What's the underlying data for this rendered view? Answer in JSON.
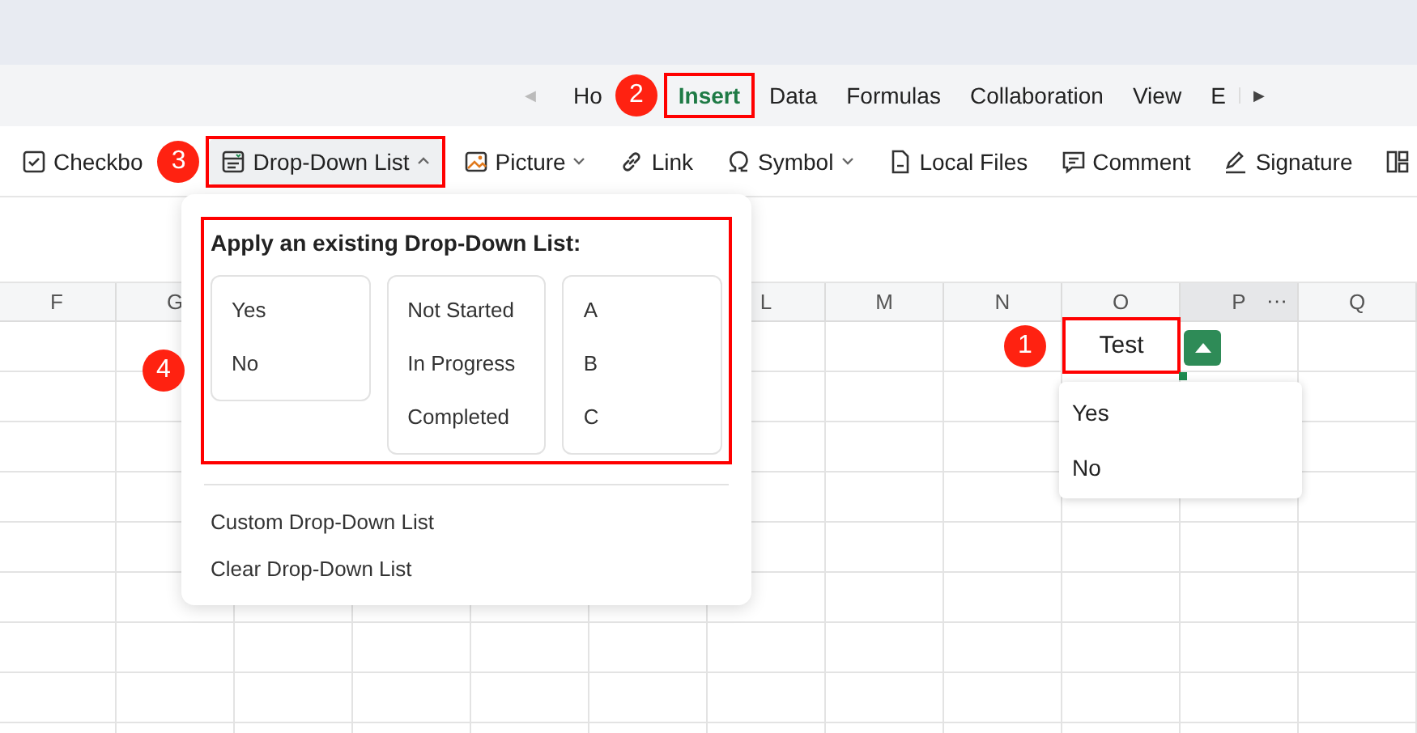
{
  "tab_bar": {
    "scroll_left": "◀",
    "scroll_right": "▶",
    "tabs": [
      {
        "label": "Ho",
        "selected": false,
        "outlined": false
      },
      {
        "label": "Insert",
        "selected": true,
        "outlined": true,
        "badge": "2"
      },
      {
        "label": "Data",
        "selected": false,
        "outlined": false
      },
      {
        "label": "Formulas",
        "selected": false,
        "outlined": false
      },
      {
        "label": "Collaboration",
        "selected": false,
        "outlined": false
      },
      {
        "label": "View",
        "selected": false,
        "outlined": false
      },
      {
        "label": "E",
        "selected": false,
        "outlined": false
      }
    ]
  },
  "toolbar": [
    {
      "kind": "checkbox",
      "label": "Checkbo",
      "has_menu": false,
      "expanded": false,
      "outlined": false
    },
    {
      "kind": "dropdown",
      "label": "Drop-Down List",
      "has_menu": true,
      "expanded": true,
      "outlined": true,
      "badge": "3"
    },
    {
      "kind": "picture",
      "label": "Picture",
      "has_menu": true,
      "expanded": false,
      "outlined": false
    },
    {
      "kind": "link",
      "label": "Link",
      "has_menu": false,
      "expanded": false,
      "outlined": false
    },
    {
      "kind": "symbol",
      "label": "Symbol",
      "has_menu": true,
      "expanded": false,
      "outlined": false
    },
    {
      "kind": "file",
      "label": "Local Files",
      "has_menu": false,
      "expanded": false,
      "outlined": false
    },
    {
      "kind": "comment",
      "label": "Comment",
      "has_menu": false,
      "expanded": false,
      "outlined": false
    },
    {
      "kind": "signature",
      "label": "Signature",
      "has_menu": false,
      "expanded": false,
      "outlined": false
    },
    {
      "kind": "layout",
      "has_menu": false,
      "expanded": false,
      "outlined": false
    }
  ],
  "popup": {
    "title": "Apply an existing Drop-Down List:",
    "outlined": true,
    "badge": "4",
    "lists": [
      {
        "options": [
          "Yes",
          "No"
        ]
      },
      {
        "options": [
          "Not Started",
          "In Progress",
          "Completed"
        ]
      },
      {
        "options": [
          "A",
          "B",
          "C"
        ]
      }
    ],
    "actions": [
      "Custom Drop-Down List",
      "Clear Drop-Down List"
    ]
  },
  "sheet": {
    "columns_left": [
      {
        "label": "F",
        "hovered": false,
        "active": false
      },
      {
        "label": "G",
        "hovered": false,
        "active": false
      }
    ],
    "columns_right": [
      {
        "label": "L",
        "hovered": false,
        "active": false
      },
      {
        "label": "M",
        "hovered": false,
        "active": false
      },
      {
        "label": "N",
        "hovered": false,
        "active": false
      },
      {
        "label": "O",
        "hovered": false,
        "active": true
      },
      {
        "label": "P",
        "hovered": true,
        "active": false,
        "menu": "···"
      },
      {
        "label": "Q",
        "hovered": false,
        "active": false
      }
    ],
    "active_cell": {
      "value": "Test",
      "outlined": true,
      "badge": "1"
    },
    "cell_dropdown": {
      "options": [
        "Yes",
        "No"
      ]
    }
  }
}
